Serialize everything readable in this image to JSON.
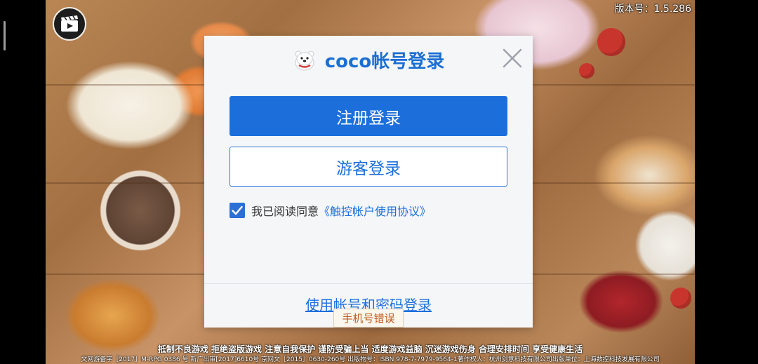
{
  "app": {
    "version": "版本号：1.5.286",
    "video_icon": "video-play-icon"
  },
  "dialog": {
    "logo_icon": "polar-bear-logo-icon",
    "title": "coco帐号登录",
    "close_icon": "close-icon",
    "register_login_label": "注册登录",
    "guest_login_label": "游客登录",
    "agreement": {
      "checked": true,
      "prefix": "我已阅读同意",
      "link": "《触控帐户使用协议》"
    },
    "alt_login_label": "使用帐号和密码登录"
  },
  "toast": {
    "message": "手机号错误"
  },
  "footer": {
    "line1": "抵制不良游戏 拒绝盗版游戏 注意自我保护 谨防受骗上当 适度游戏益脑 沉迷游戏伤身 合理安排时间 享受健康生活",
    "line2": "文网游备字［2017］M-RPG 0386 号 新广出审[2017]6610号 京网文［2015］0630-260号 出版物号：ISBN 978-7-7979-9564-1著作权人：杭州剑意科技有限公司出版单位：上海数控科技发展有限公司"
  },
  "colors": {
    "accent": "#1c6fdb",
    "dialog_bg": "#f5f6f8",
    "toast_text": "#c2571a"
  }
}
